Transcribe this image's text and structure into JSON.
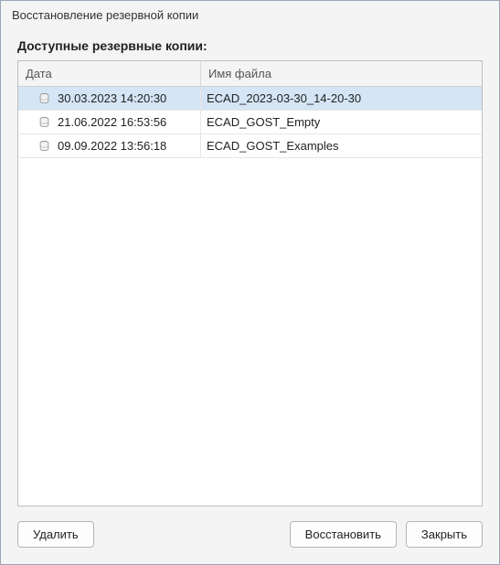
{
  "window": {
    "title": "Восстановление резервной копии"
  },
  "section": {
    "heading": "Доступные резервные копии:"
  },
  "table": {
    "headers": {
      "date": "Дата",
      "filename": "Имя файла"
    },
    "rows": [
      {
        "date": "30.03.2023 14:20:30",
        "filename": "ECAD_2023-03-30_14-20-30",
        "selected": true
      },
      {
        "date": "21.06.2022 16:53:56",
        "filename": "ECAD_GOST_Empty",
        "selected": false
      },
      {
        "date": "09.09.2022 13:56:18",
        "filename": "ECAD_GOST_Examples",
        "selected": false
      }
    ]
  },
  "buttons": {
    "delete": "Удалить",
    "restore": "Восстановить",
    "close": "Закрыть"
  },
  "icons": {
    "database": "database-icon"
  }
}
